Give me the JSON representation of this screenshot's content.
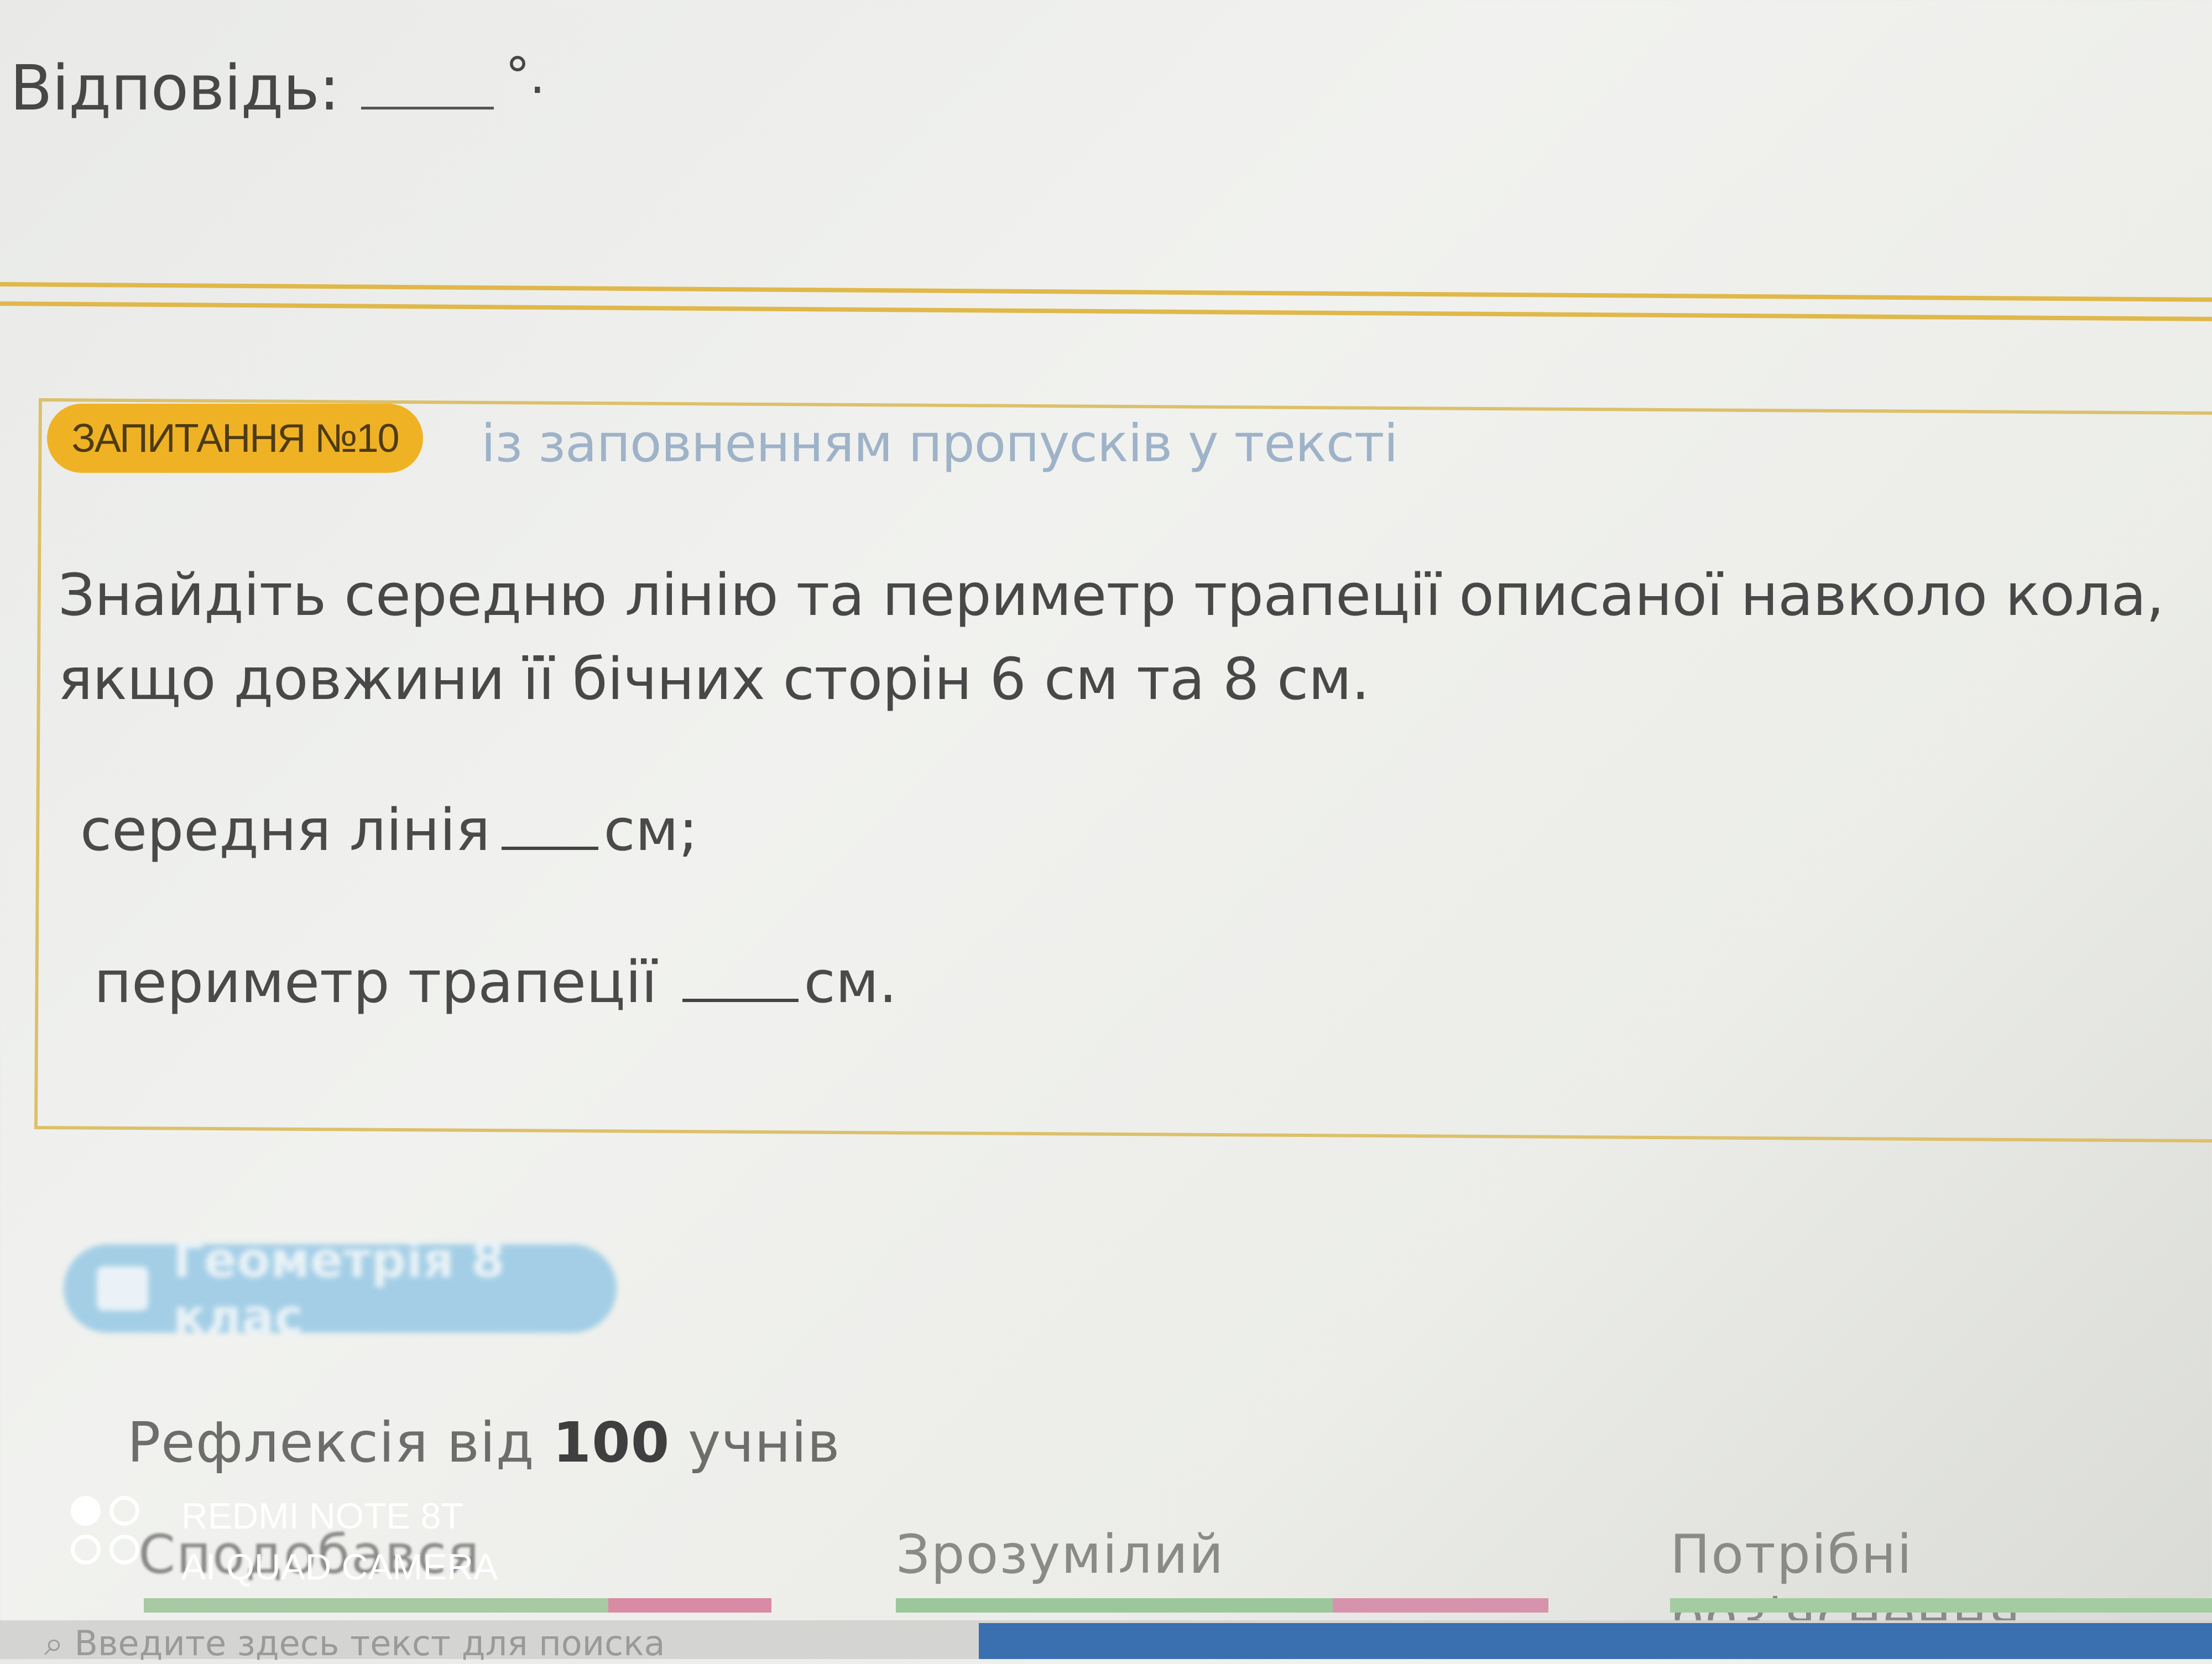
{
  "previous_question": {
    "answer_label": "Відповідь:",
    "answer_unit": "°."
  },
  "question": {
    "badge": "ЗАПИТАННЯ №10",
    "type": "із заповненням пропусків у тексті",
    "text": "Знайдіть середню лінію та периметр трапеції описаної навколо кола, якщо довжини її бічних сторін 6 см та 8 см.",
    "row1_label": "середня лінія",
    "row1_unit": "см;",
    "row2_label": "периметр трапеції",
    "row2_unit": "см."
  },
  "topic": {
    "label": "Геометрія 8 клас"
  },
  "reflection": {
    "prefix": "Рефлексія від",
    "count": "100",
    "suffix": "учнів",
    "options": [
      "Сподобався",
      "Зрозумілий",
      "Потрібні роз'яснення"
    ]
  },
  "taskbar": {
    "search_placeholder": "Введите здесь текст для поиска"
  },
  "watermark": {
    "line1": "REDMI NOTE 8T",
    "line2": "AI QUAD CAMERA"
  }
}
